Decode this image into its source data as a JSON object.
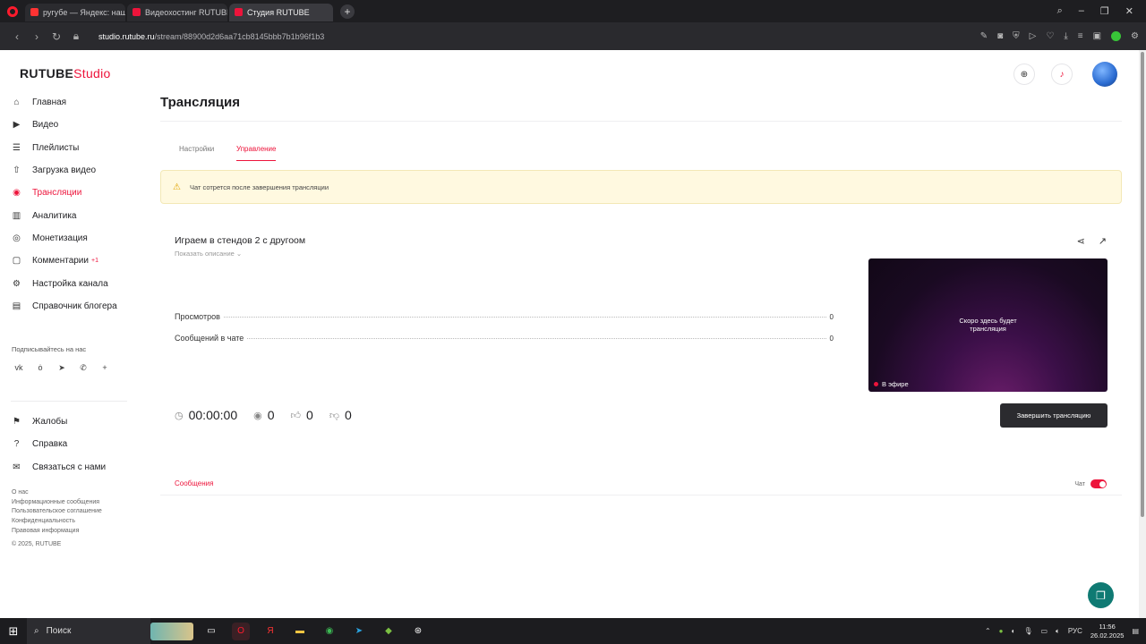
{
  "browser": {
    "tabs": [
      {
        "label": "ругубе — Яндекс: нашлось",
        "favicon_color": "#ff3333",
        "active": false
      },
      {
        "label": "Видеохостинг RUTUBE. С",
        "favicon_color": "#ed143b",
        "active": false
      },
      {
        "label": "Студия RUTUBE",
        "favicon_color": "#ed143b",
        "active": true
      }
    ],
    "new_tab": "+",
    "url_domain": "studio.rutube.ru",
    "url_path": "/stream/88900d2d6aa71cb8145bbb7b1b96f1b3"
  },
  "brand": {
    "name": "RUTUBE",
    "suffix": "Studio",
    "accent": "#ed143b"
  },
  "sidebar": {
    "items": [
      {
        "label": "Главная",
        "icon": "home-icon"
      },
      {
        "label": "Видео",
        "icon": "video-icon"
      },
      {
        "label": "Плейлисты",
        "icon": "playlist-icon"
      },
      {
        "label": "Загрузка видео",
        "icon": "upload-icon"
      },
      {
        "label": "Трансляции",
        "icon": "broadcast-icon",
        "active": true
      },
      {
        "label": "Аналитика",
        "icon": "analytics-icon"
      },
      {
        "label": "Монетизация",
        "icon": "monetization-icon"
      },
      {
        "label": "Комментарии",
        "icon": "comments-icon",
        "badge": "+1"
      },
      {
        "label": "Настройка канала",
        "icon": "gear-icon"
      },
      {
        "label": "Справочник блогера",
        "icon": "book-icon"
      }
    ],
    "subscribe_title": "Подписывайтесь на нас",
    "socials": [
      "vk",
      "ok",
      "telegram",
      "viber",
      "more"
    ],
    "secondary": [
      {
        "label": "Жалобы",
        "icon": "flag-icon"
      },
      {
        "label": "Справка",
        "icon": "help-icon"
      },
      {
        "label": "Связаться с нами",
        "icon": "mail-icon"
      }
    ],
    "footer_links": [
      "О нас",
      "Информационные сообщения",
      "Пользовательское соглашение",
      "Конфиденциальность",
      "Правовая информация"
    ],
    "copyright": "© 2025, RUTUBE"
  },
  "main": {
    "title": "Трансляция",
    "tabs": [
      {
        "label": "Настройки",
        "active": false
      },
      {
        "label": "Управление",
        "active": true
      }
    ],
    "alert": "Чат сотрется после завершения трансляции",
    "stream": {
      "title": "Играем в стендов 2 с другоом",
      "show_description": "Показать описание",
      "stats": [
        {
          "label": "Просмотров",
          "value": "0"
        },
        {
          "label": "Сообщений в чате",
          "value": "0"
        }
      ],
      "duration": "00:00:00",
      "viewers": "0",
      "likes": "0",
      "dislikes": "0",
      "preview_text_line1": "Скоро здесь будет",
      "preview_text_line2": "трансляция",
      "live_label": "В эфире",
      "end_button": "Завершить трансляцию"
    },
    "messages": {
      "tab": "Сообщения",
      "chat_label": "Чат",
      "chat_enabled": true
    }
  },
  "taskbar": {
    "search_placeholder": "Поиск",
    "language": "РУС",
    "time": "11:56",
    "date": "26.02.2025"
  }
}
